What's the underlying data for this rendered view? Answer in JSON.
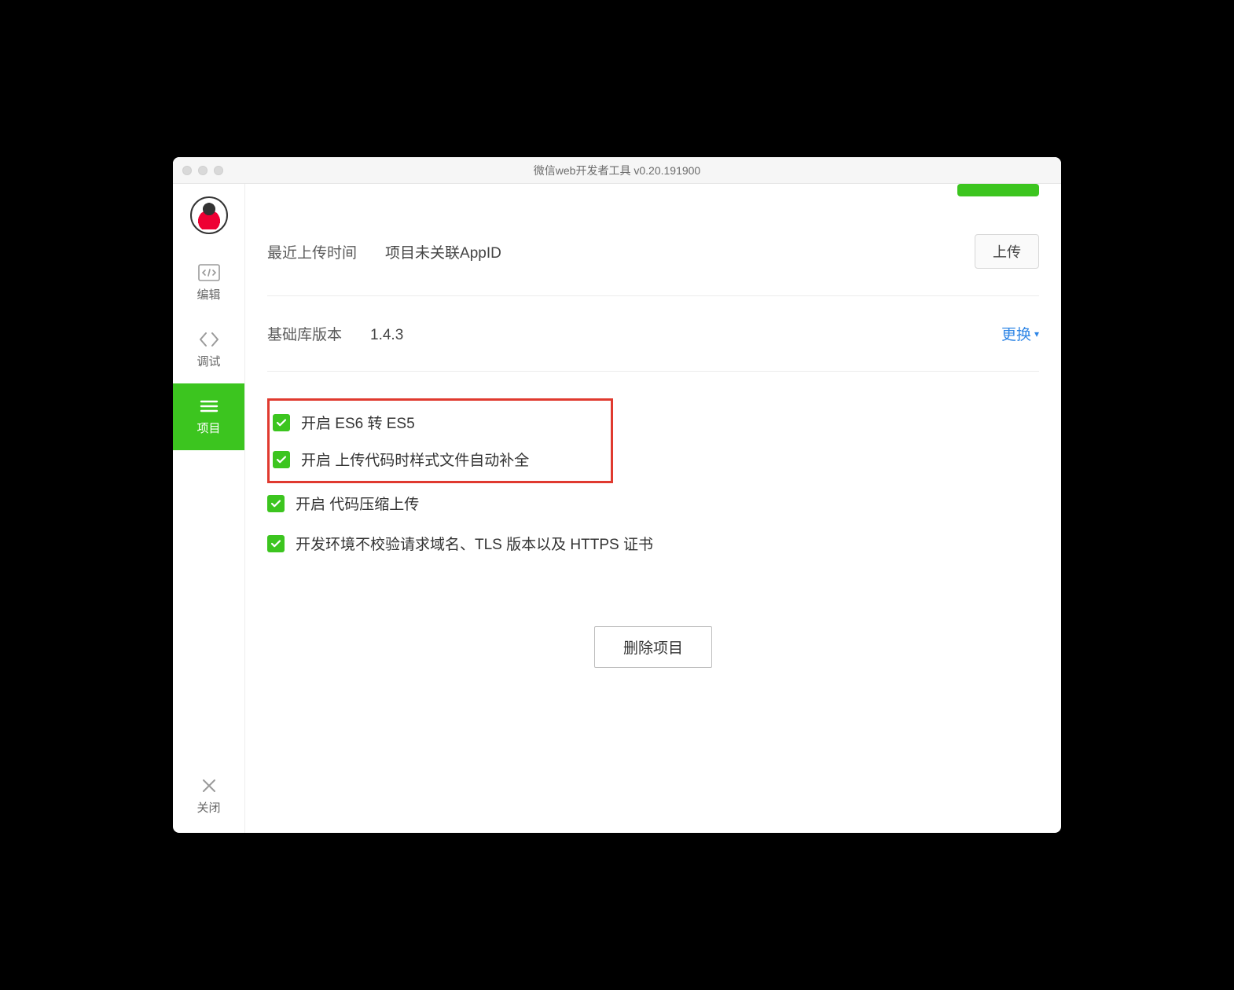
{
  "window": {
    "title": "微信web开发者工具 v0.20.191900"
  },
  "sidebar": {
    "items": [
      {
        "key": "edit",
        "label": "编辑"
      },
      {
        "key": "debug",
        "label": "调试"
      },
      {
        "key": "project",
        "label": "项目"
      }
    ],
    "close_label": "关闭"
  },
  "upload": {
    "label": "最近上传时间",
    "value": "项目未关联AppID",
    "button": "上传"
  },
  "lib": {
    "label": "基础库版本",
    "value": "1.4.3",
    "change": "更换"
  },
  "options": [
    {
      "label": "开启 ES6 转 ES5"
    },
    {
      "label": "开启 上传代码时样式文件自动补全"
    },
    {
      "label": "开启 代码压缩上传"
    },
    {
      "label": "开发环境不校验请求域名、TLS 版本以及 HTTPS 证书"
    }
  ],
  "delete_button": "删除项目",
  "colors": {
    "accent": "#3cc51f",
    "highlight": "#e03a2f",
    "link": "#2f86e6"
  }
}
